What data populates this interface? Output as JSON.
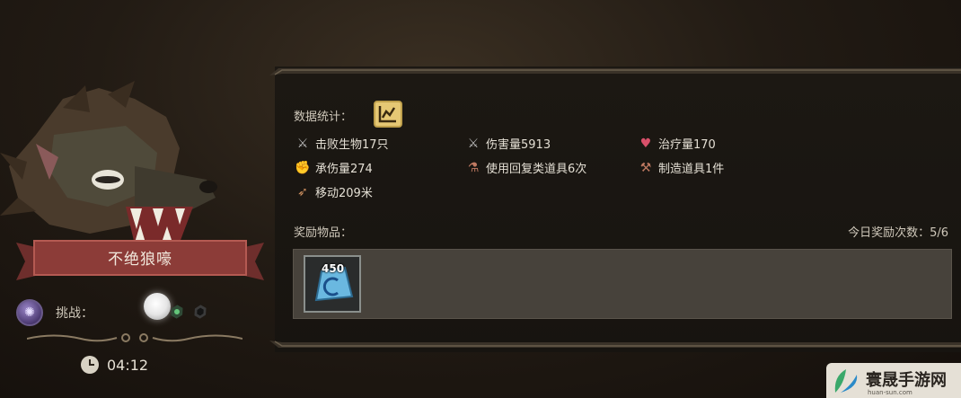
{
  "character": {
    "name": "不绝狼嚎"
  },
  "challenge": {
    "label": "挑战："
  },
  "timer": {
    "value": "04:12"
  },
  "stats": {
    "title": "数据统计：",
    "items": [
      {
        "icon": "sword-icon",
        "text": "击败生物17只"
      },
      {
        "icon": "sword-icon",
        "text": "伤害量5913"
      },
      {
        "icon": "heart-icon",
        "text": "治疗量170"
      },
      {
        "icon": "arm-icon",
        "text": "承伤量274"
      },
      {
        "icon": "potion-icon",
        "text": "使用回复类道具6次"
      },
      {
        "icon": "craft-icon",
        "text": "制造道具1件"
      },
      {
        "icon": "boot-icon",
        "text": "移动209米"
      }
    ]
  },
  "rewards": {
    "title": "奖励物品：",
    "daily_count": "今日奖励次数：5/6",
    "items": [
      {
        "icon": "crystal-icon",
        "count": "450"
      }
    ]
  },
  "colors": {
    "banner_red": "#8c3c38",
    "accent_gold": "#e6c874"
  }
}
